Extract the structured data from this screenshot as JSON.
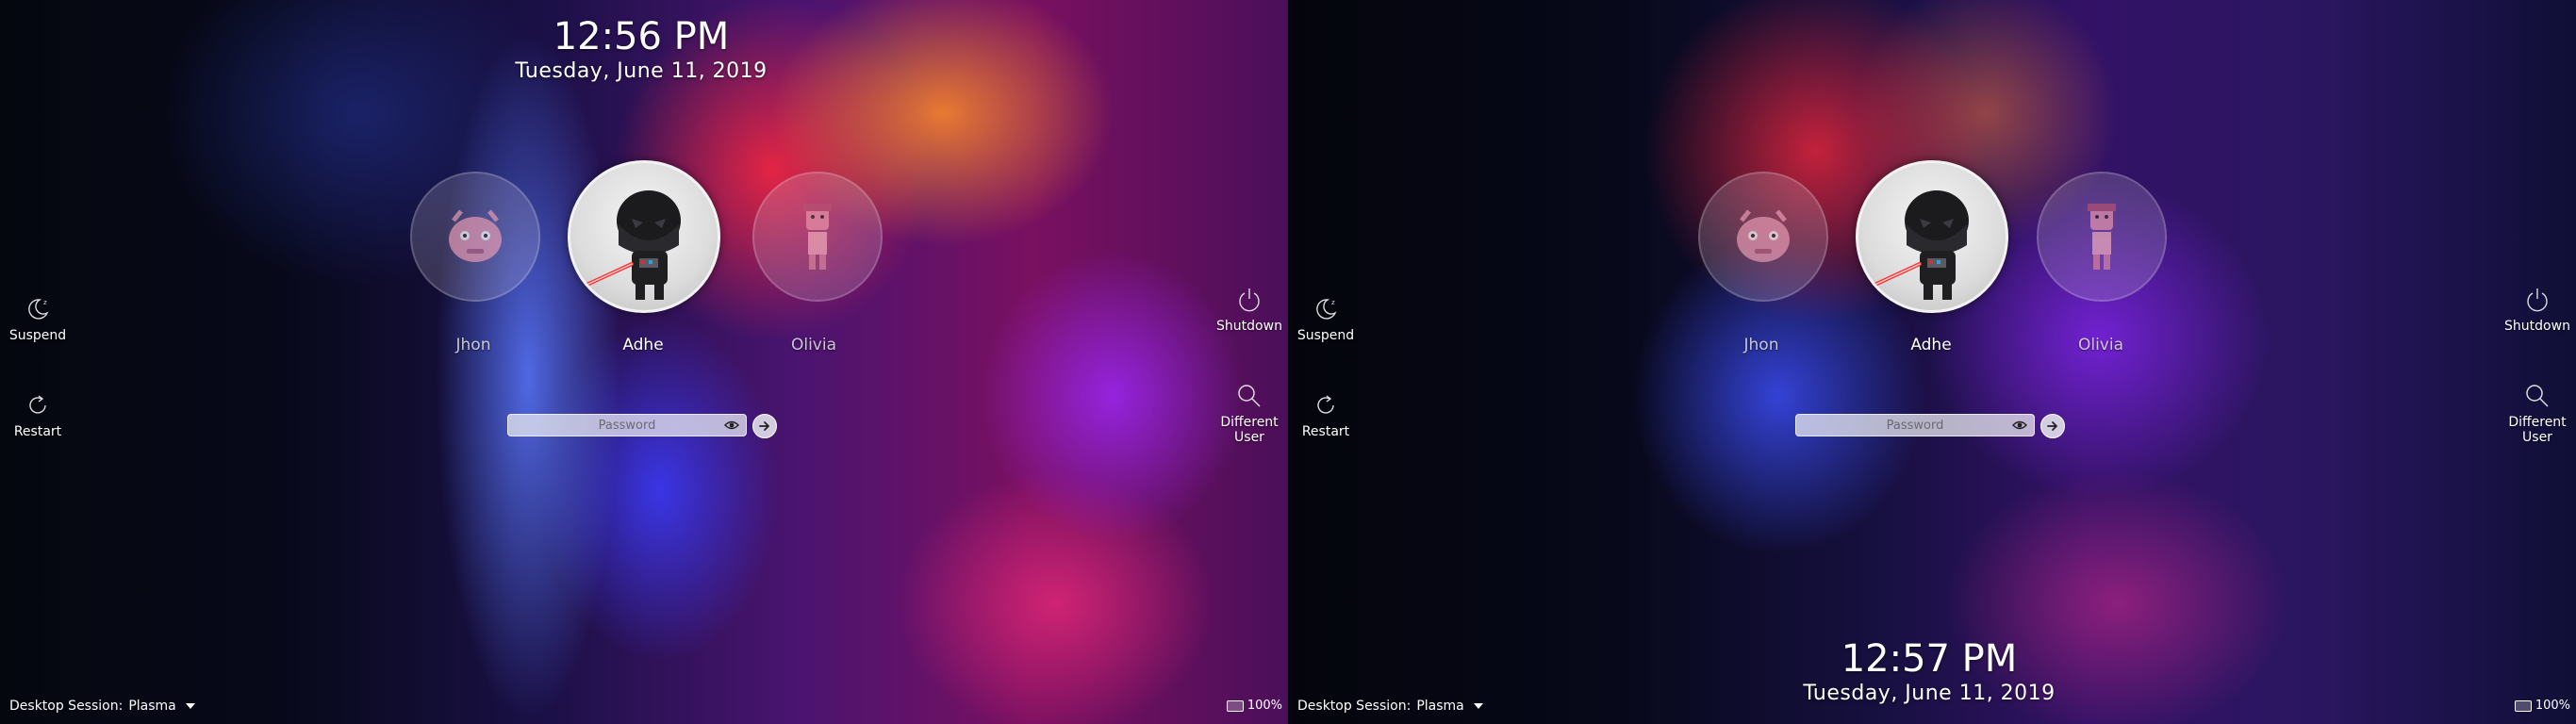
{
  "screens": [
    {
      "id": "left",
      "clock": {
        "time": "12:56 PM",
        "date": "Tuesday, June 11, 2019"
      },
      "users": [
        {
          "name": "Jhon",
          "avatar_icon": "pink-robot-avatar-icon",
          "selected": false
        },
        {
          "name": "Adhe",
          "avatar_icon": "darth-vader-avatar-icon",
          "selected": true
        },
        {
          "name": "Olivia",
          "avatar_icon": "pink-girl-avatar-icon",
          "selected": false
        }
      ],
      "password": {
        "placeholder": "Password",
        "value": ""
      },
      "actions": {
        "suspend": "Suspend",
        "restart": "Restart",
        "shutdown": "Shutdown",
        "different_user_line1": "Different",
        "different_user_line2": "User"
      },
      "session": {
        "label": "Desktop Session:",
        "value": "Plasma"
      },
      "battery": {
        "percent": "100%"
      }
    },
    {
      "id": "right",
      "clock": {
        "time": "12:57 PM",
        "date": "Tuesday, June 11, 2019"
      },
      "users": [
        {
          "name": "Jhon",
          "avatar_icon": "pink-robot-avatar-icon",
          "selected": false
        },
        {
          "name": "Adhe",
          "avatar_icon": "darth-vader-avatar-icon",
          "selected": true
        },
        {
          "name": "Olivia",
          "avatar_icon": "pink-girl-avatar-icon",
          "selected": false
        }
      ],
      "password": {
        "placeholder": "Password",
        "value": ""
      },
      "actions": {
        "suspend": "Suspend",
        "restart": "Restart",
        "shutdown": "Shutdown",
        "different_user_line1": "Different",
        "different_user_line2": "User"
      },
      "session": {
        "label": "Desktop Session:",
        "value": "Plasma"
      },
      "battery": {
        "percent": "100%"
      }
    }
  ],
  "colors": {
    "text": "#ffffff",
    "field_bg": "#ebebf2",
    "lightsaber_red": "#ff2a2a"
  }
}
